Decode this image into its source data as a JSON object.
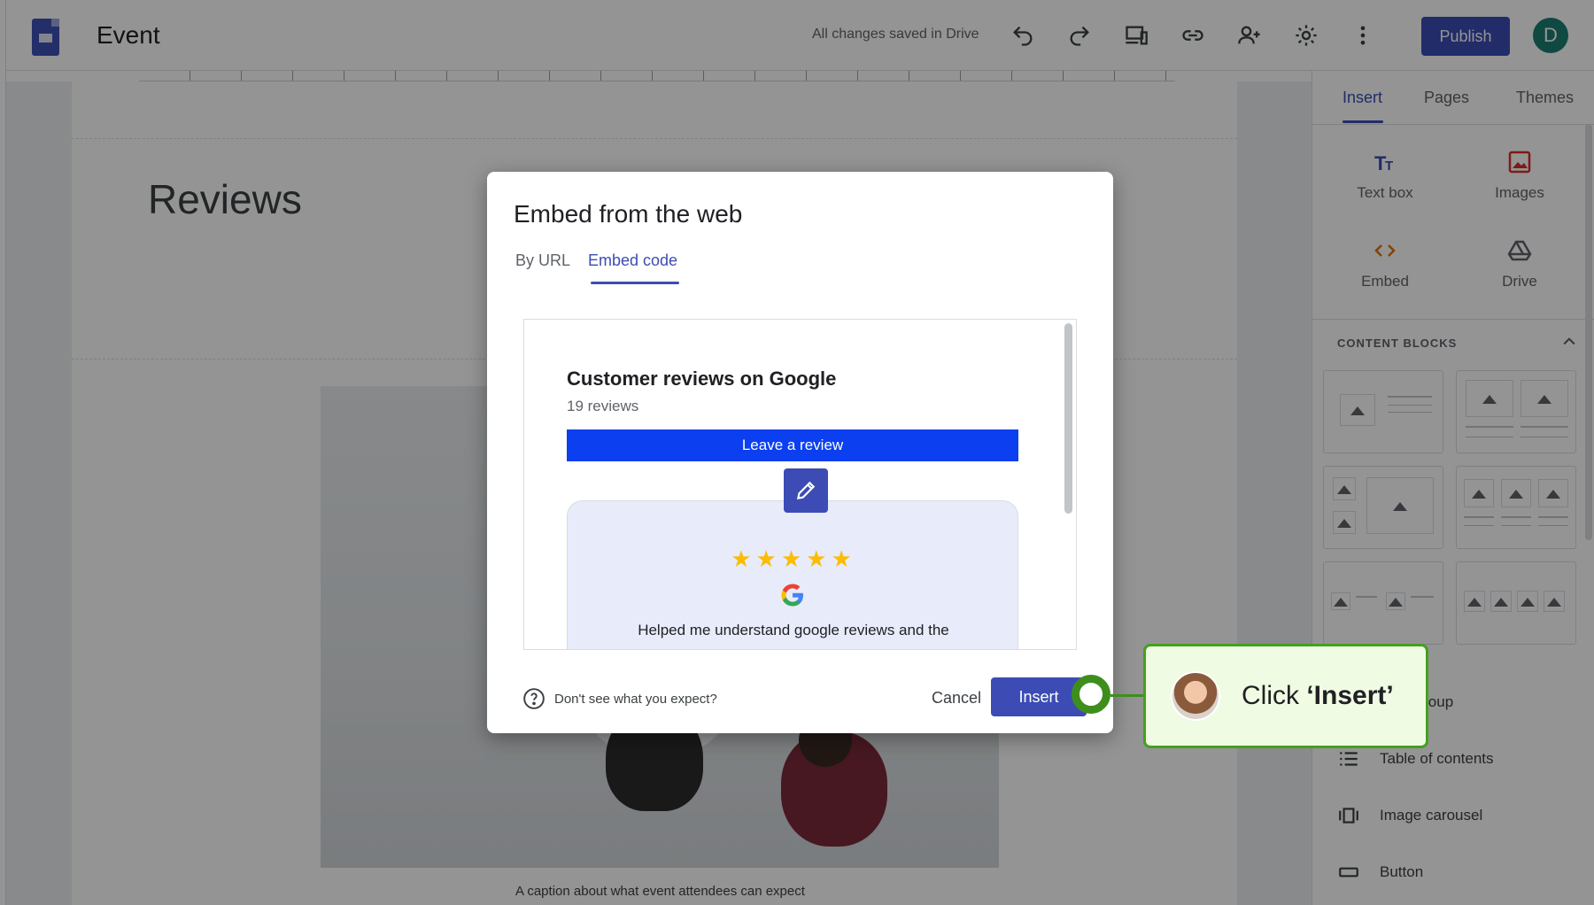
{
  "app": {
    "doc_title": "Event",
    "save_status": "All changes saved in Drive",
    "publish_label": "Publish",
    "avatar_letter": "D"
  },
  "page": {
    "heading": "Reviews",
    "caption": "A caption about what event attendees can expect"
  },
  "side_panel": {
    "tabs": [
      {
        "label": "Insert",
        "active": true
      },
      {
        "label": "Pages",
        "active": false
      },
      {
        "label": "Themes",
        "active": false
      }
    ],
    "insert_items": [
      {
        "label": "Text box",
        "icon": "text-box-icon"
      },
      {
        "label": "Images",
        "icon": "image-icon"
      },
      {
        "label": "Embed",
        "icon": "embed-code-icon"
      },
      {
        "label": "Drive",
        "icon": "drive-icon"
      }
    ],
    "content_blocks_heading": "CONTENT BLOCKS",
    "list_items": [
      {
        "label": "sible group",
        "icon": "collapsible-group-icon"
      },
      {
        "label": "Table of contents",
        "icon": "table-of-contents-icon"
      },
      {
        "label": "Image carousel",
        "icon": "image-carousel-icon"
      },
      {
        "label": "Button",
        "icon": "button-icon"
      }
    ]
  },
  "dialog": {
    "title": "Embed from the web",
    "tabs": [
      {
        "label": "By URL",
        "active": false
      },
      {
        "label": "Embed code",
        "active": true
      }
    ],
    "preview": {
      "title": "Customer reviews on Google",
      "count": "19 reviews",
      "button_label": "Leave a review",
      "rating_stars": 5,
      "stars_text": "★★★★★",
      "review_text": "Helped me understand google reviews and the"
    },
    "help_text": "Don't see what you expect?",
    "cancel_label": "Cancel",
    "insert_label": "Insert"
  },
  "callout": {
    "prefix": "Click ",
    "target": "‘Insert’"
  },
  "colors": {
    "accent": "#3c4cb4",
    "callout_border": "#43a020",
    "callout_bg": "#f0fbe3",
    "review_button": "#0b3ff0",
    "stars": "#fbbc04"
  }
}
